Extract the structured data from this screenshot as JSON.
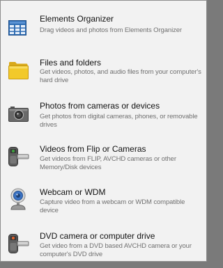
{
  "items": [
    {
      "icon": "elements-organizer-grid-icon",
      "title": "Elements Organizer",
      "description": "Drag videos and photos from Elements Organizer"
    },
    {
      "icon": "folder-icon",
      "title": "Files and folders",
      "description": "Get videos, photos, and audio files from your computer's hard drive"
    },
    {
      "icon": "camera-icon",
      "title": "Photos from cameras or devices",
      "description": "Get photos from digital cameras, phones, or removable drives"
    },
    {
      "icon": "flip-camcorder-icon",
      "title": "Videos from Flip or Cameras",
      "description": "Get videos from FLIP, AVCHD cameras or other Memory/Disk devices"
    },
    {
      "icon": "webcam-icon",
      "title": "Webcam or WDM",
      "description": "Capture video from a webcam or WDM compatible device"
    },
    {
      "icon": "dvd-camcorder-icon",
      "title": "DVD camera or computer drive",
      "description": "Get video from a DVD based AVCHD camera or your computer's DVD drive"
    }
  ],
  "colors": {
    "panel_background": "#f2f2f2",
    "title_text": "#111111",
    "description_text": "#707070",
    "grid_icon_blue": "#2f6db3",
    "folder_yellow": "#f2c92a"
  }
}
